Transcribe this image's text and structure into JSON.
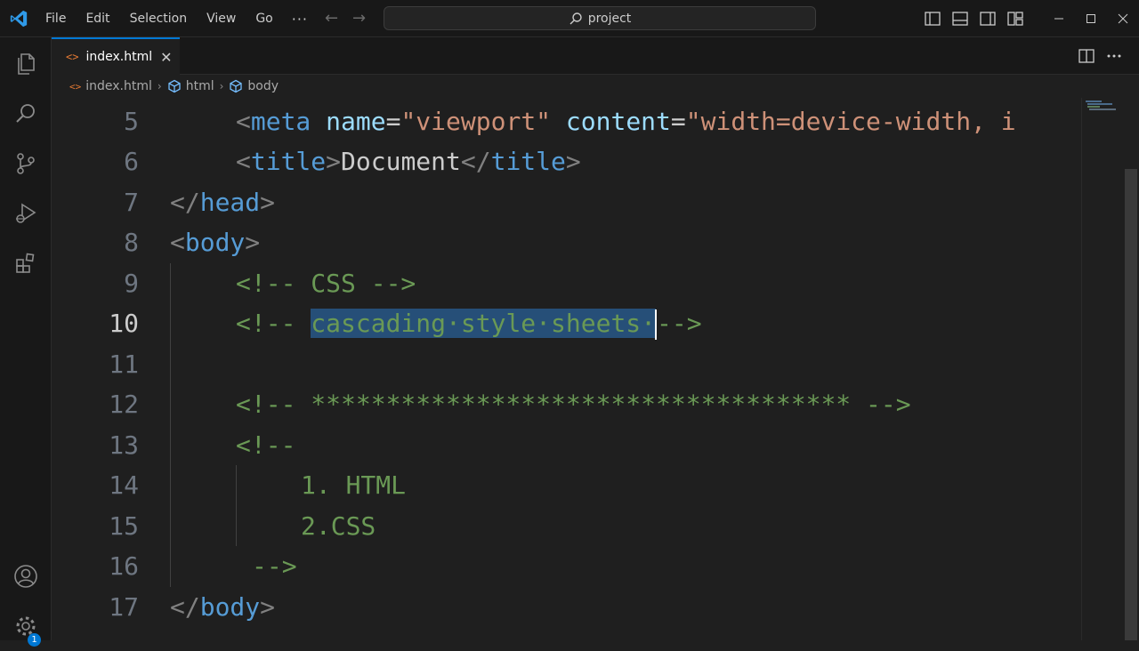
{
  "menu": {
    "file": "File",
    "edit": "Edit",
    "selection": "Selection",
    "view": "View",
    "go": "Go",
    "more": "···"
  },
  "search": {
    "text": "project"
  },
  "tab": {
    "icon": "<>",
    "label": "index.html",
    "close": "✕"
  },
  "breadcrumbs": [
    {
      "label": "index.html"
    },
    {
      "label": "html"
    },
    {
      "label": "body"
    }
  ],
  "line_numbers": [
    "5",
    "6",
    "7",
    "8",
    "9",
    "10",
    "11",
    "12",
    "13",
    "14",
    "15",
    "16",
    "17"
  ],
  "active_line": "10",
  "code": {
    "l5": {
      "open": "<",
      "tag": "meta",
      "attr1": "name",
      "eq1": "=",
      "val1": "\"viewport\"",
      "attr2": "content",
      "eq2": "=",
      "val2": "\"width=device-width, i"
    },
    "l6": {
      "open": "<",
      "tag": "title",
      "close": ">",
      "text": "Document",
      "open2": "</",
      "tag2": "title",
      "close2": ">"
    },
    "l7": {
      "open": "</",
      "tag": "head",
      "close": ">"
    },
    "l8": {
      "open": "<",
      "tag": "body",
      "close": ">"
    },
    "l9": {
      "comment": "<!-- CSS -->"
    },
    "l10": {
      "start": "<!-- ",
      "selected": "cascading·style·sheets·",
      "end": "-->"
    },
    "l12": {
      "comment": "<!-- ************************************ -->"
    },
    "l13": {
      "comment": "<!--"
    },
    "l14": {
      "comment": "1. HTML"
    },
    "l15": {
      "comment": "2.CSS"
    },
    "l16": {
      "comment": "-->"
    },
    "l17": {
      "open": "</",
      "tag": "body",
      "close": ">"
    }
  },
  "accounts_badge": "1",
  "colors": {
    "accent": "#0078d4",
    "selection": "#264f78",
    "comment": "#6a9955",
    "tag": "#569cd6",
    "attribute": "#9cdcfe",
    "string": "#ce9178"
  }
}
